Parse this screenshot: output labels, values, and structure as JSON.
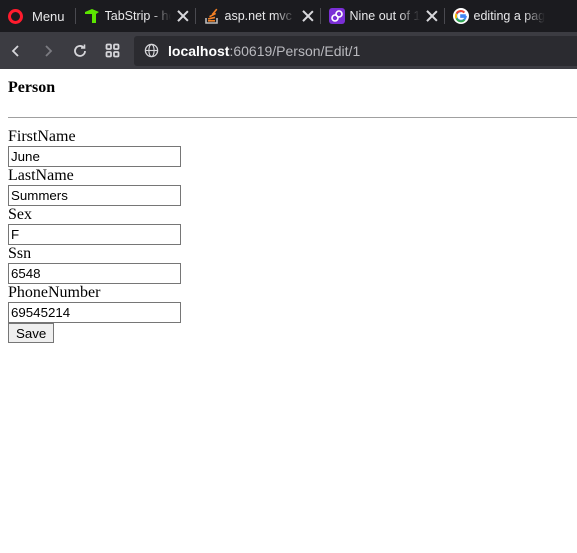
{
  "browser": {
    "menu_label": "Menu",
    "tabs": [
      {
        "title": "TabStrip - ho",
        "icon": "telerik-icon",
        "icon_color": "#5ce500"
      },
      {
        "title": "asp.net mvc -",
        "icon": "stackoverflow-icon",
        "icon_color": "#f48024"
      },
      {
        "title": "Nine out of 1",
        "icon": "link-icon",
        "icon_color": "#7b2fd6"
      },
      {
        "title": "editing a pag",
        "icon": "google-icon",
        "icon_color": "#4285f4"
      }
    ],
    "url_host": "localhost",
    "url_path": ":60619/Person/Edit/1",
    "accent": "#ff1b2d"
  },
  "page": {
    "title": "Person",
    "fields": [
      {
        "label": "FirstName",
        "value": "June"
      },
      {
        "label": "LastName",
        "value": "Summers"
      },
      {
        "label": "Sex",
        "value": "F"
      },
      {
        "label": "Ssn",
        "value": "6548"
      },
      {
        "label": "PhoneNumber",
        "value": "69545214"
      }
    ],
    "save_label": "Save"
  }
}
